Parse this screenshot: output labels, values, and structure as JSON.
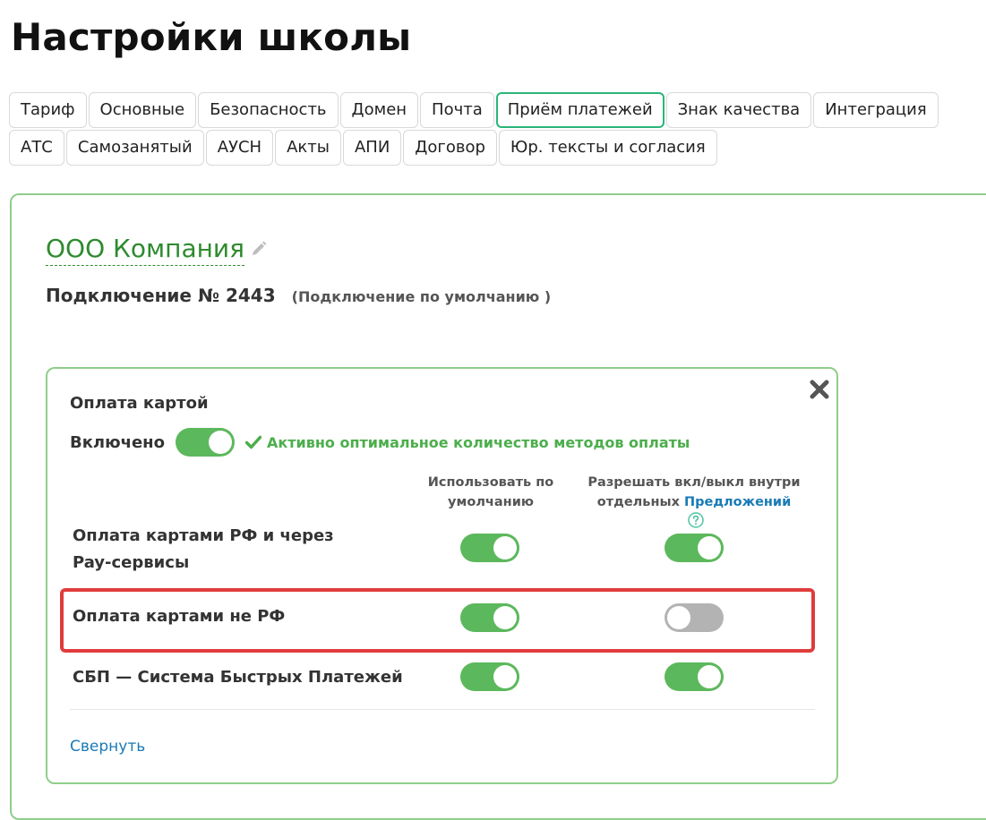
{
  "page": {
    "title": "Настройки школы"
  },
  "tabs": [
    {
      "label": "Тариф",
      "active": false
    },
    {
      "label": "Основные",
      "active": false
    },
    {
      "label": "Безопасность",
      "active": false
    },
    {
      "label": "Домен",
      "active": false
    },
    {
      "label": "Почта",
      "active": false
    },
    {
      "label": "Приём платежей",
      "active": true
    },
    {
      "label": "Знак качества",
      "active": false
    },
    {
      "label": "Интеграция",
      "active": false
    },
    {
      "label": "АТС",
      "active": false
    },
    {
      "label": "Самозанятый",
      "active": false
    },
    {
      "label": "АУСН",
      "active": false
    },
    {
      "label": "Акты",
      "active": false
    },
    {
      "label": "АПИ",
      "active": false
    },
    {
      "label": "Договор",
      "active": false
    },
    {
      "label": "Юр. тексты и согласия",
      "active": false
    }
  ],
  "company": {
    "name": "ООО Компания",
    "edit_icon": "pencil-icon"
  },
  "connection": {
    "title": "Подключение № 2443",
    "note": "(Подключение по умолчанию )"
  },
  "card_payment": {
    "title": "Оплата картой",
    "enabled_label": "Включено",
    "enabled": true,
    "status_text": "Активно оптимальное количество методов оплаты",
    "close_icon": "close-icon",
    "columns": {
      "use_default_line1": "Использовать по",
      "use_default_line2": "умолчанию",
      "allow_toggle_line1": "Разрешать вкл/выкл внутри",
      "allow_toggle_line2_prefix": "отдельных",
      "allow_toggle_link": "Предложений",
      "help_icon": "question-circle-icon"
    },
    "methods": [
      {
        "label": "Оплата картами РФ и через Pay-сервисы",
        "use_default": true,
        "allow_toggle": true
      },
      {
        "label": "Оплата картами не РФ",
        "use_default": true,
        "allow_toggle": false,
        "highlighted": true
      },
      {
        "label": "СБП — Система Быстрых Платежей",
        "use_default": true,
        "allow_toggle": true
      }
    ],
    "collapse_label": "Свернуть"
  },
  "colors": {
    "accent_green": "#5cb85c",
    "tab_active_border": "#2bb57a",
    "company_link": "#2e8b2e",
    "link_blue": "#1a7bb5",
    "highlight_red": "#e03c3c",
    "switch_off": "#b3b3b3"
  }
}
